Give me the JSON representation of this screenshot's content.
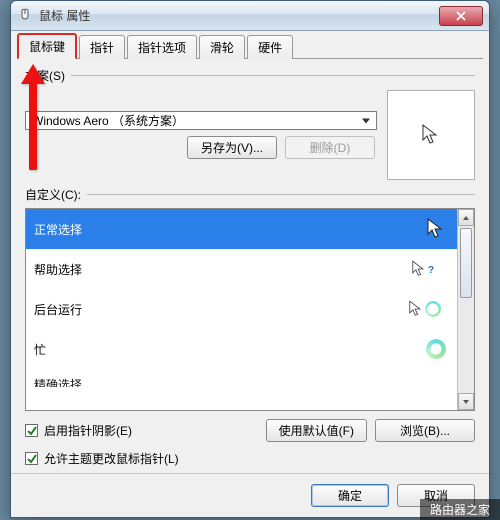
{
  "window": {
    "title": "鼠标 属性"
  },
  "tabs": {
    "t0": "鼠标键",
    "t1": "指针",
    "t2": "指针选项",
    "t3": "滑轮",
    "t4": "硬件"
  },
  "scheme": {
    "label": "方案(S)",
    "selected": "Windows Aero （系统方案）",
    "saveAs": "另存为(V)...",
    "delete": "删除(D)"
  },
  "customize": {
    "label": "自定义(C):",
    "items": [
      {
        "name": "正常选择",
        "icon": "arrow"
      },
      {
        "name": "帮助选择",
        "icon": "arrow-help"
      },
      {
        "name": "后台运行",
        "icon": "arrow-ring"
      },
      {
        "name": "忙",
        "icon": "ring"
      },
      {
        "name": "精确选择",
        "icon": "cross"
      }
    ]
  },
  "below": {
    "defaults": "使用默认值(F)",
    "browse": "浏览(B)..."
  },
  "checks": {
    "shadow": "启用指针阴影(E)",
    "theme": "允许主题更改鼠标指针(L)"
  },
  "footer": {
    "ok": "确定",
    "cancel": "取消"
  },
  "wm": {
    "a": "",
    "b": "路由器之家"
  }
}
